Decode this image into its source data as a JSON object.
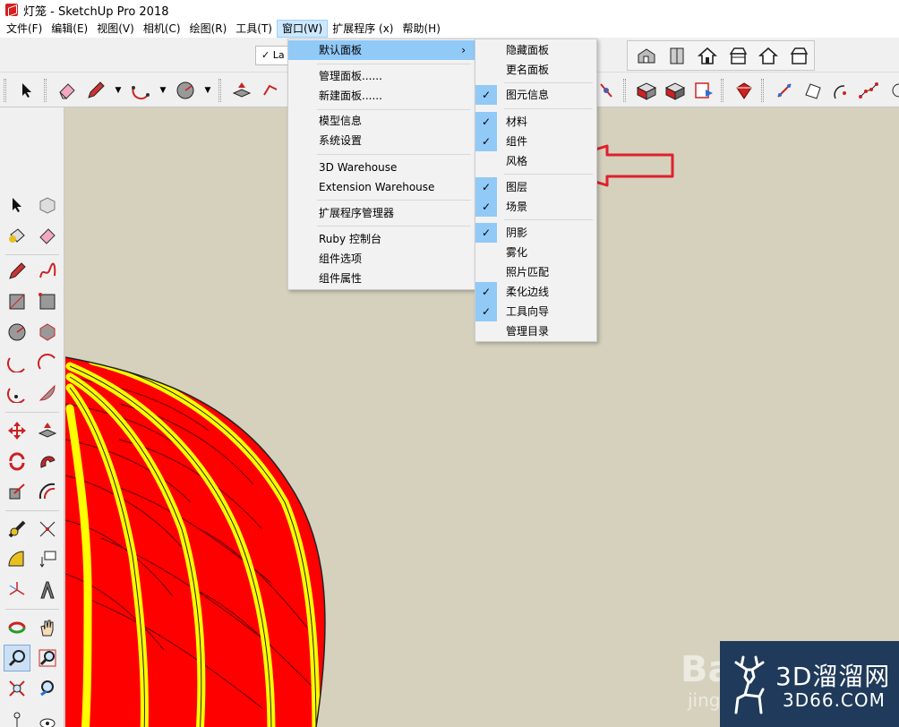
{
  "window": {
    "title": "灯笼 - SketchUp Pro 2018"
  },
  "menubar": {
    "items": [
      "文件(F)",
      "编辑(E)",
      "视图(V)",
      "相机(C)",
      "绘图(R)",
      "工具(T)",
      "窗口(W)",
      "扩展程序 (x)",
      "帮助(H)"
    ]
  },
  "toolbar": {
    "layer_value": "La",
    "layer_check": "✓"
  },
  "window_menu": {
    "items": [
      {
        "label": "默认面板",
        "has_submenu": true
      },
      {
        "label": "管理面板......"
      },
      {
        "label": "新建面板......"
      },
      {
        "label": "模型信息"
      },
      {
        "label": "系统设置"
      },
      {
        "label": "3D Warehouse"
      },
      {
        "label": "Extension Warehouse"
      },
      {
        "label": "扩展程序管理器"
      },
      {
        "label": "Ruby 控制台"
      },
      {
        "label": "组件选项"
      },
      {
        "label": "组件属性"
      }
    ],
    "chevron": "›"
  },
  "default_panel_submenu": {
    "items": [
      {
        "label": "隐藏面板",
        "checked": false
      },
      {
        "label": "更名面板",
        "checked": false
      },
      {
        "label": "图元信息",
        "checked": true
      },
      {
        "label": "材料",
        "checked": true
      },
      {
        "label": "组件",
        "checked": true
      },
      {
        "label": "风格",
        "checked": false
      },
      {
        "label": "图层",
        "checked": true
      },
      {
        "label": "场景",
        "checked": true
      },
      {
        "label": "阴影",
        "checked": true
      },
      {
        "label": "雾化",
        "checked": false
      },
      {
        "label": "照片匹配",
        "checked": false
      },
      {
        "label": "柔化边线",
        "checked": true
      },
      {
        "label": "工具向导",
        "checked": true
      },
      {
        "label": "管理目录",
        "checked": false
      }
    ],
    "check_glyph": "✓"
  },
  "watermark": {
    "brand_big": "3D溜溜网",
    "brand_small": "3D66.COM",
    "baidu": "Ba",
    "baidu_sub": "jing"
  },
  "colors": {
    "menu_highlight": "#91c9f7",
    "lantern_red": "#ff0000",
    "lantern_yellow": "#ffff00",
    "arrow_red": "#e0202a"
  }
}
